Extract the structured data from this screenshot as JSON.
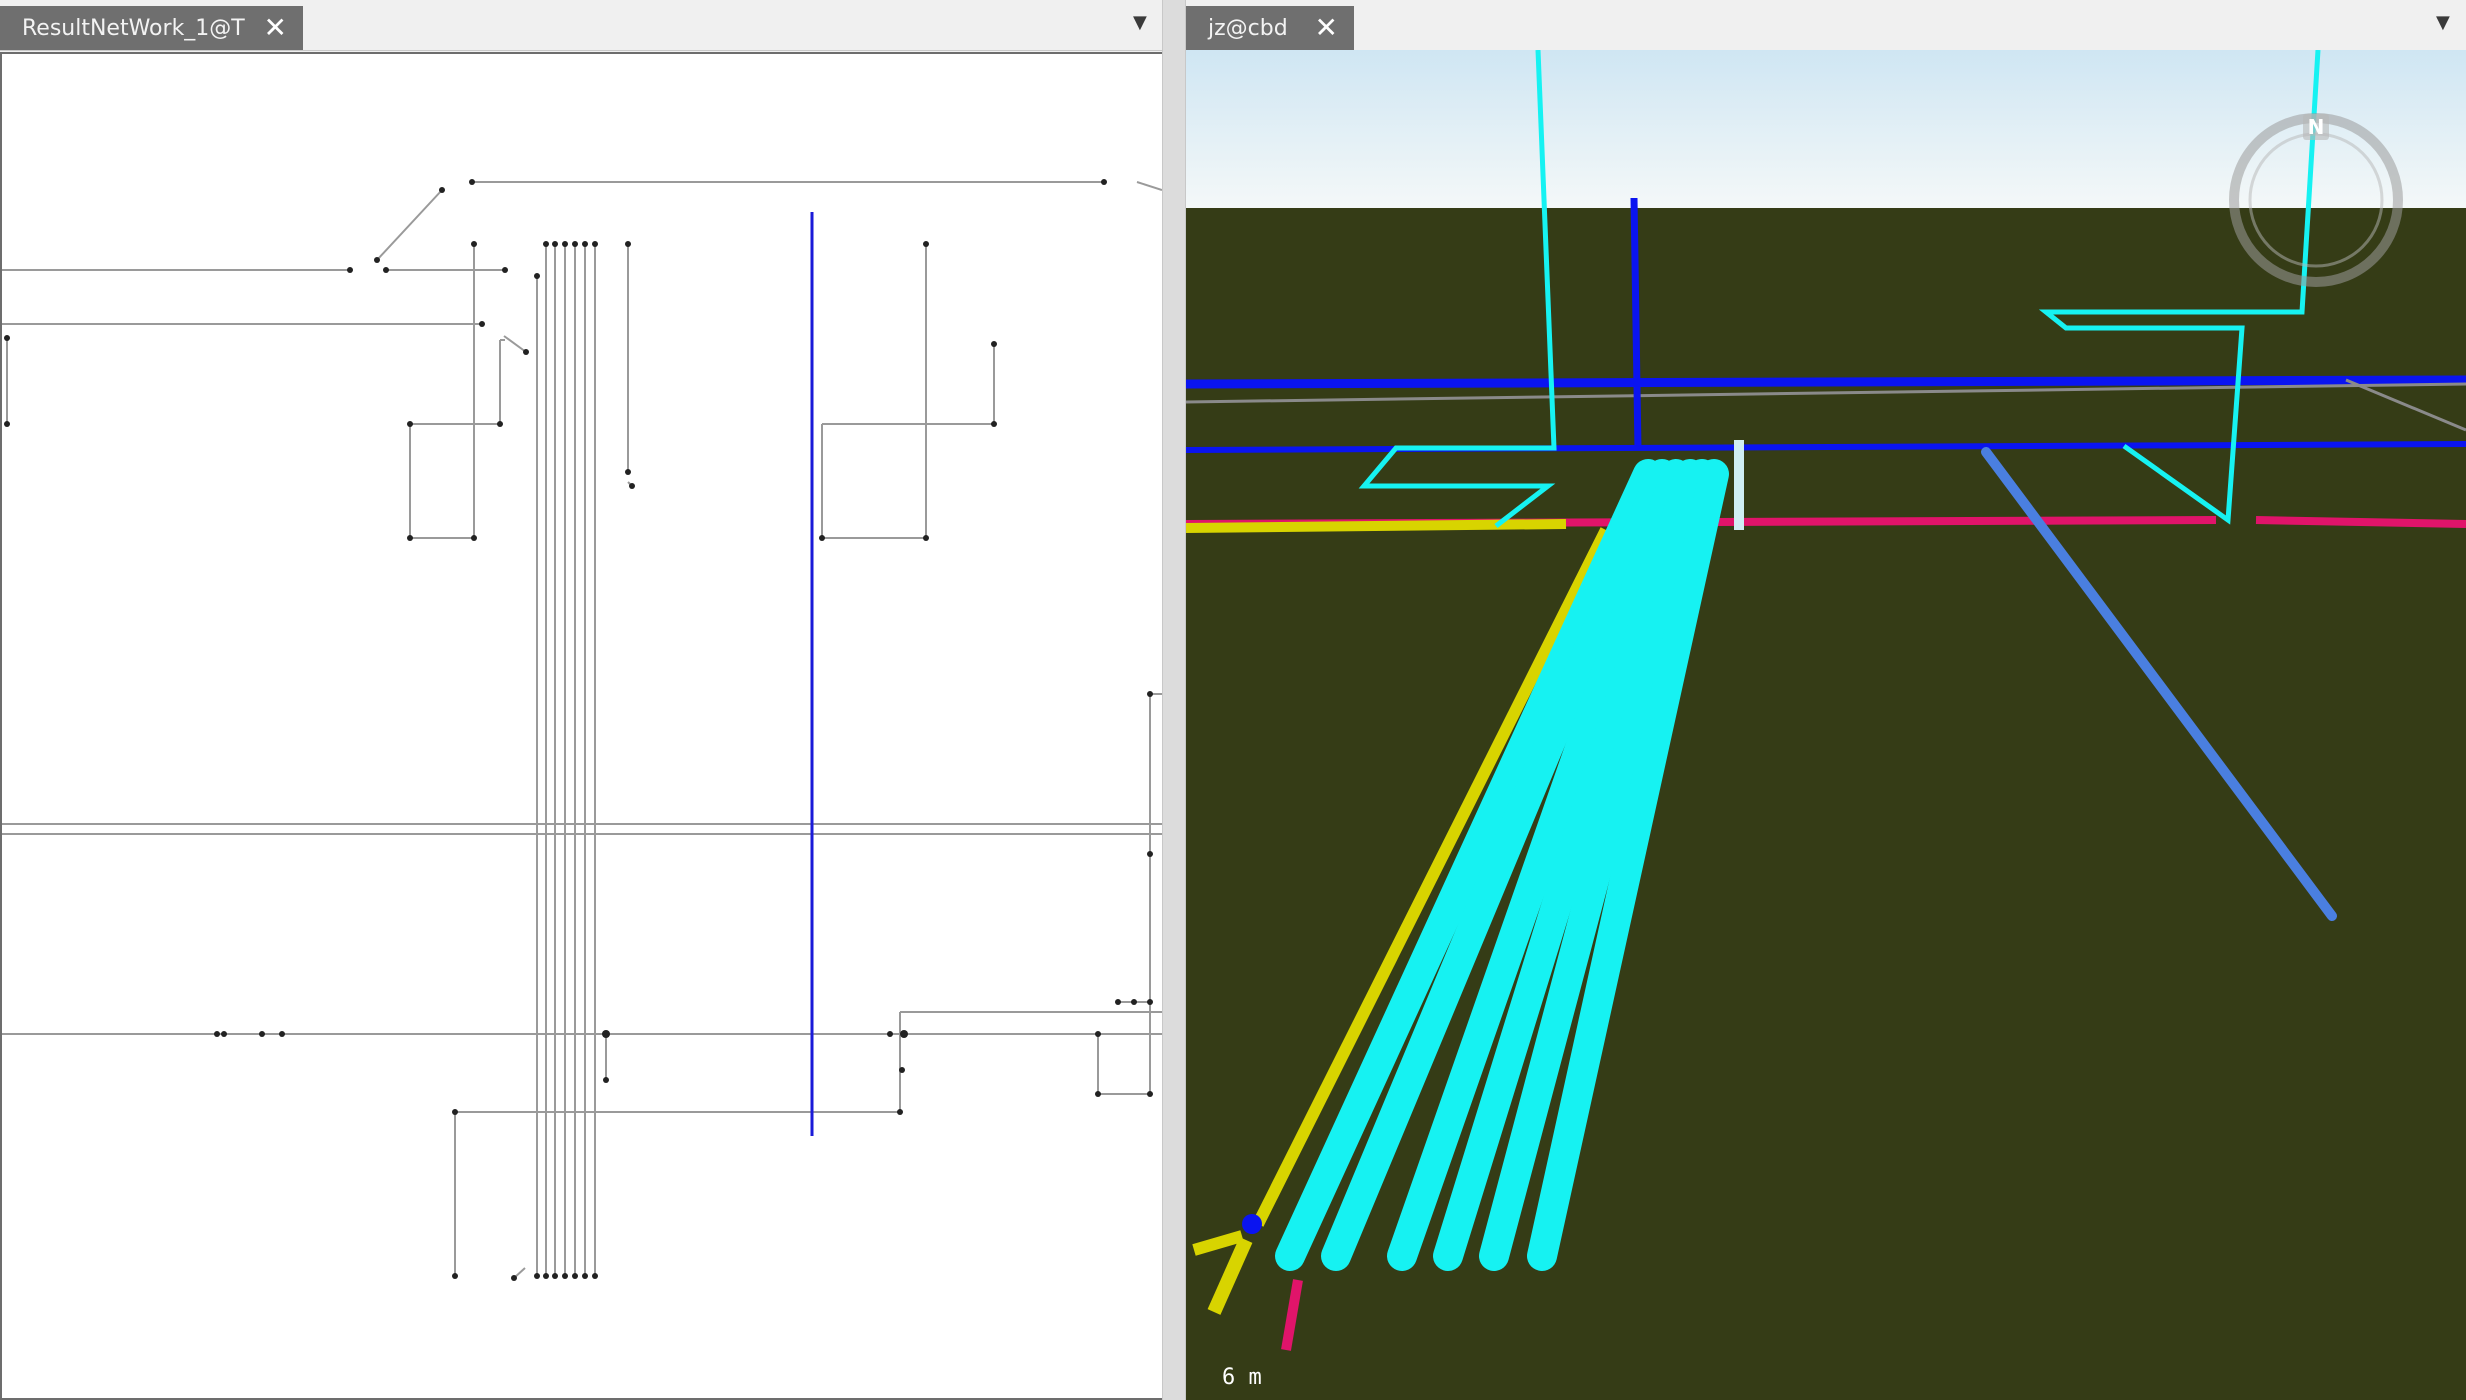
{
  "left_panel": {
    "tab_label": "ResultNetWork_1@T",
    "close_glyph": "✕",
    "menu_glyph": "▼"
  },
  "right_panel": {
    "tab_label": "jz@cbd",
    "close_glyph": "✕",
    "menu_glyph": "▼",
    "compass_letter": "N",
    "scale_text": "6  m"
  },
  "colors": {
    "tab_bg": "#6f6f6f",
    "ground": "#353c16",
    "sky_top": "#cfe6f3",
    "network_line": "#9a9a9a",
    "network_highlight": "#1a1ad8",
    "pipe_cyan": "#16f2f2",
    "pipe_blue": "#0a14f0",
    "pipe_yellow": "#d8d400",
    "pipe_magenta": "#e0146a",
    "pipe_steel_blue": "#4a7fe0"
  },
  "icons": {
    "close": "close-icon",
    "dropdown": "chevron-down-icon",
    "compass": "compass-icon"
  }
}
